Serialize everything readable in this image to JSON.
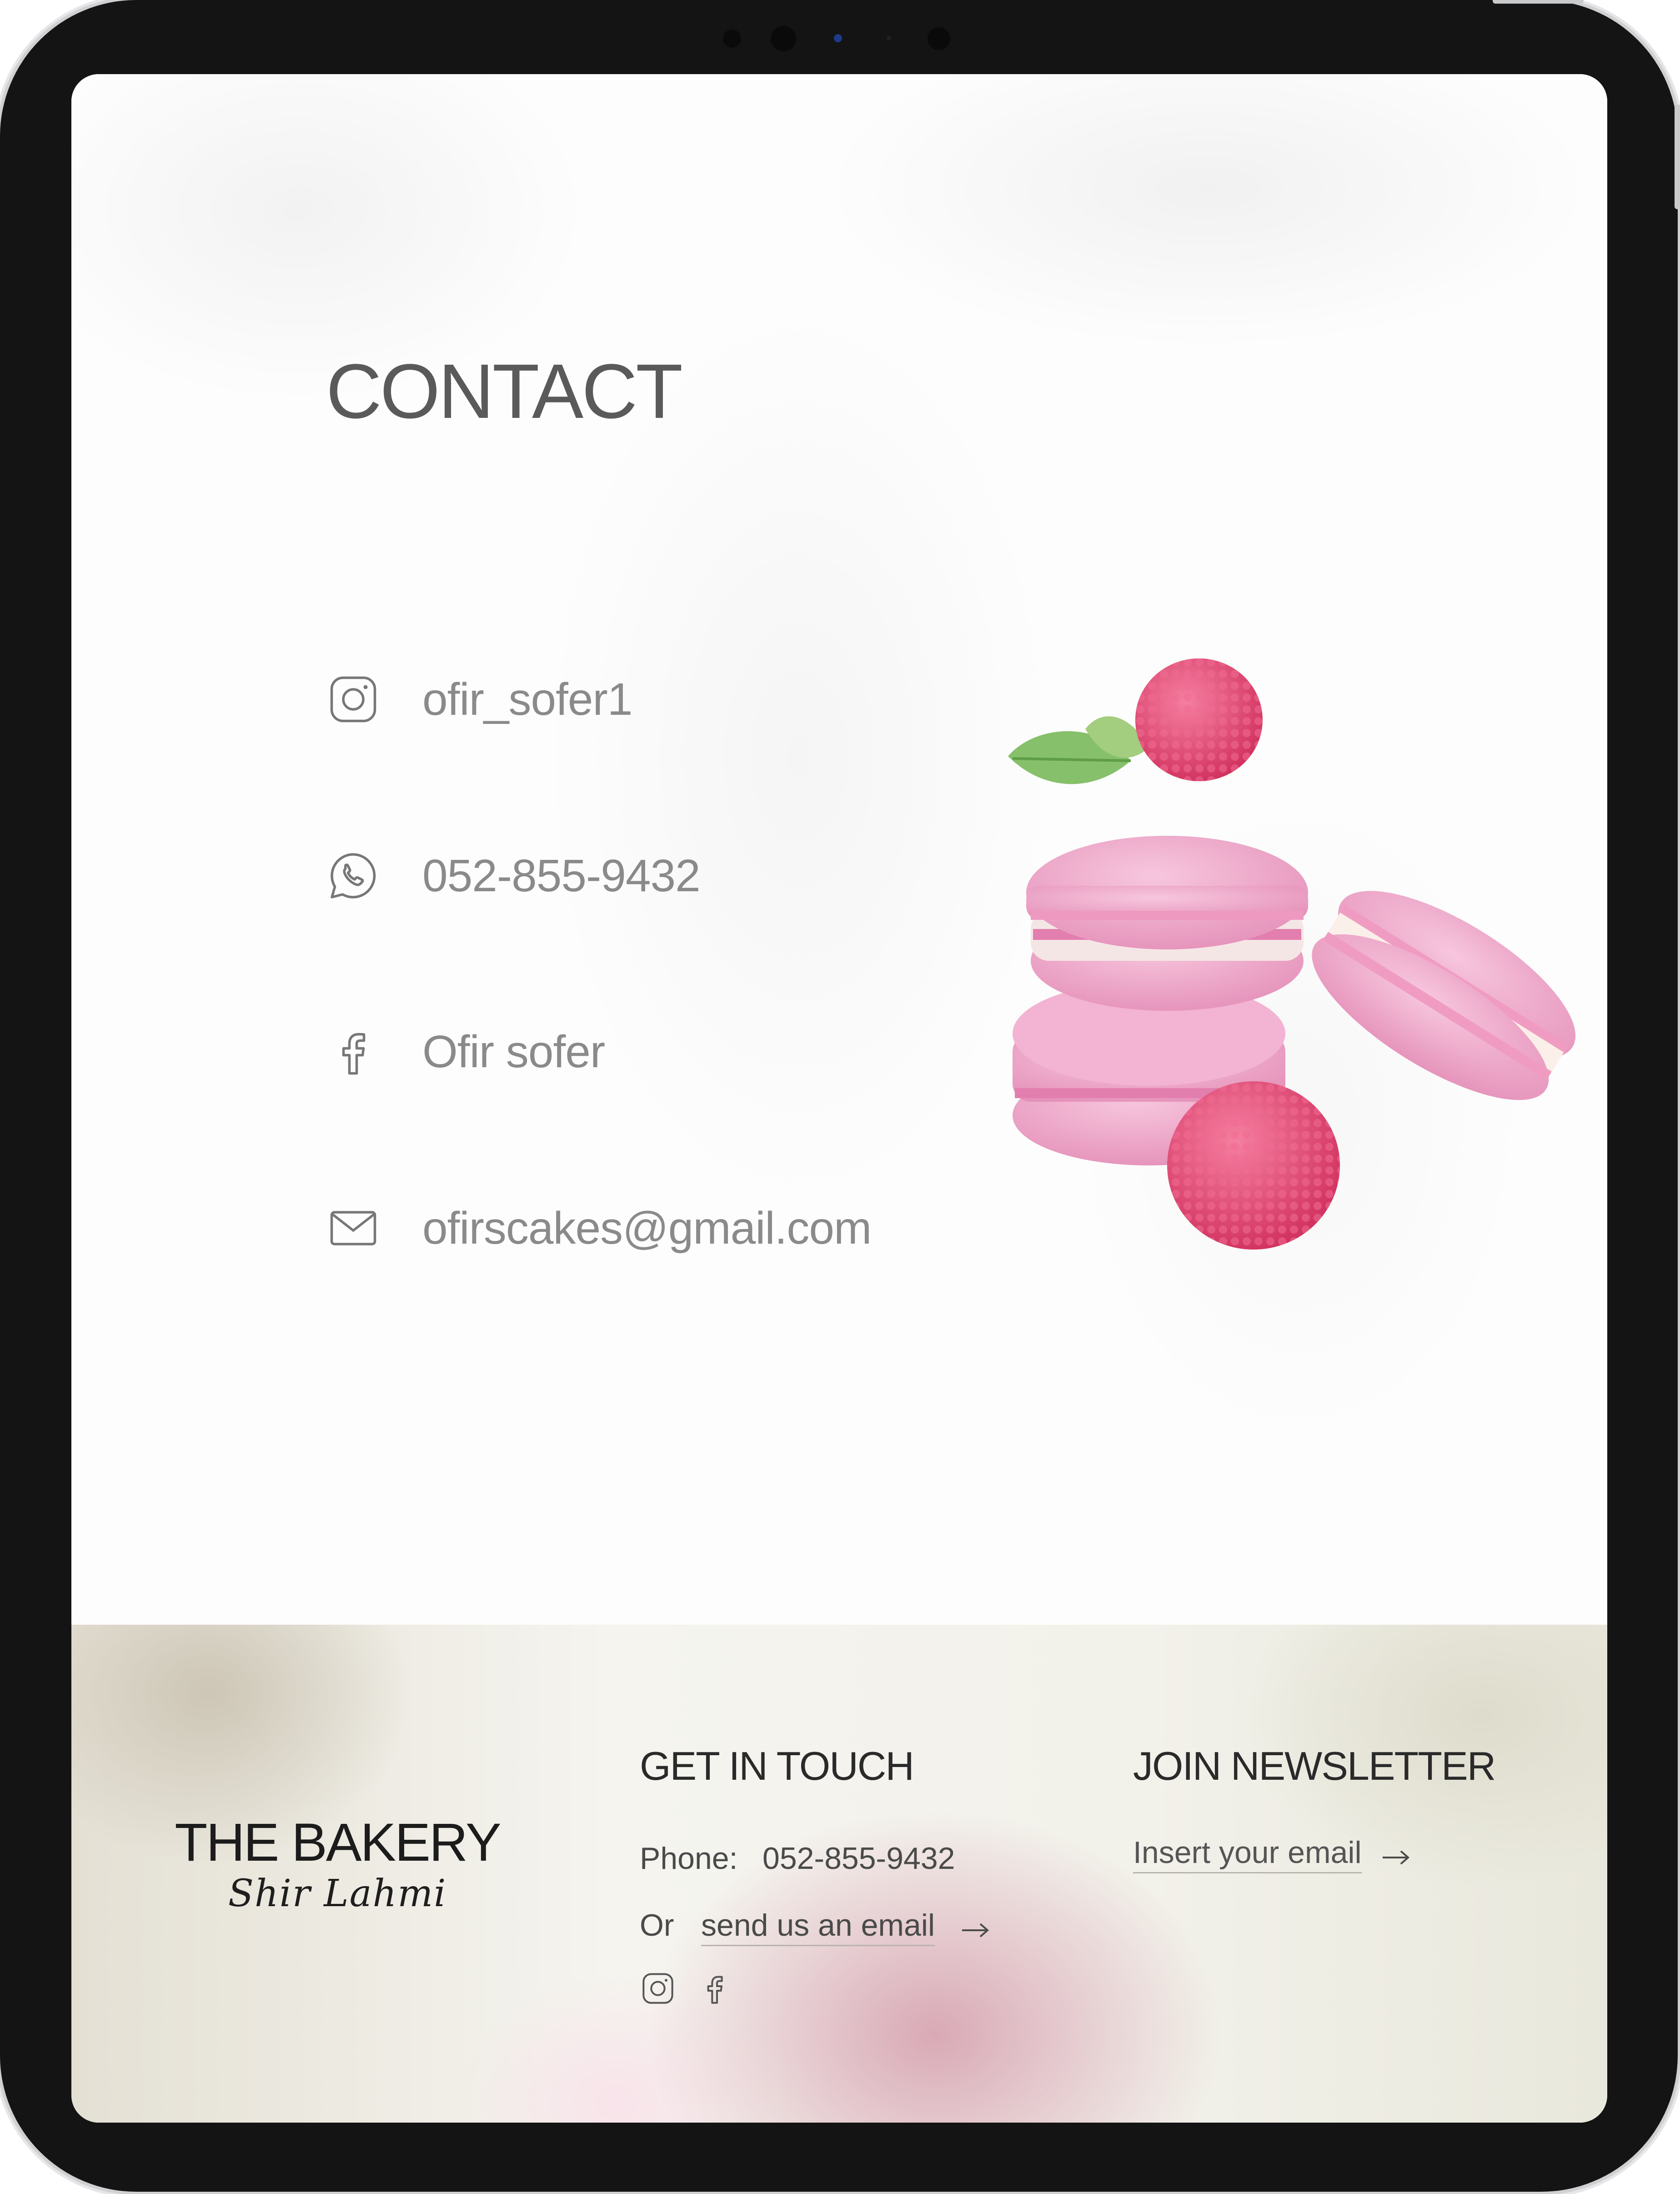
{
  "contact": {
    "title": "CONTACT",
    "items": [
      {
        "icon": "instagram-icon",
        "text": "ofir_sofer1"
      },
      {
        "icon": "whatsapp-icon",
        "text": "052-855-9432"
      },
      {
        "icon": "facebook-icon",
        "text": "Ofir sofer"
      },
      {
        "icon": "mail-icon",
        "text": "ofirscakes@gmail.com"
      }
    ]
  },
  "footer": {
    "brand": {
      "name": "THE BAKERY",
      "subtitle": "Shir Lahmi"
    },
    "get_in_touch": {
      "heading": "GET IN TOUCH",
      "phone_label": "Phone:",
      "phone_value": "052-855-9432",
      "or_label": "Or",
      "email_link": "send us an email",
      "social_icons": [
        "instagram-icon",
        "facebook-icon"
      ]
    },
    "newsletter": {
      "heading": "JOIN NEWSLETTER",
      "input_placeholder": "Insert your email"
    }
  },
  "colors": {
    "device_frame": "#141414",
    "text_gray": "#8a8a8a",
    "macaron_pink": "#eda0c5",
    "raspberry": "#e0406e",
    "footer_blush": "#d9a9b6"
  }
}
